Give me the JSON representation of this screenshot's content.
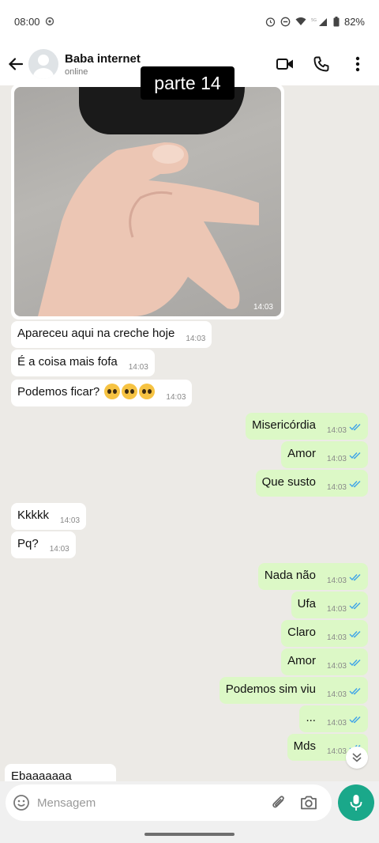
{
  "status_bar": {
    "time": "08:00",
    "battery": "82%"
  },
  "header": {
    "contact_name": "Baba internet",
    "status": "online"
  },
  "overlay": {
    "label": "parte 14"
  },
  "photo": {
    "time": "14:03"
  },
  "messages_in": [
    {
      "text": "Apareceu aqui na creche hoje",
      "time": "14:03"
    },
    {
      "text": "É a coisa mais fofa",
      "time": "14:03"
    },
    {
      "text": "Podemos ficar?",
      "time": "14:03"
    },
    {
      "text": "Kkkkk",
      "time": "14:03"
    },
    {
      "text": "Pq?",
      "time": "14:03"
    },
    {
      "text": "Ebaaaaaaa",
      "time": ""
    }
  ],
  "messages_out": [
    {
      "text": "Misericórdia",
      "time": "14:03"
    },
    {
      "text": "Amor",
      "time": "14:03"
    },
    {
      "text": "Que susto",
      "time": "14:03"
    },
    {
      "text": "Nada não",
      "time": "14:03"
    },
    {
      "text": "Ufa",
      "time": "14:03"
    },
    {
      "text": "Claro",
      "time": "14:03"
    },
    {
      "text": "Amor",
      "time": "14:03"
    },
    {
      "text": "Podemos sim viu",
      "time": "14:03"
    },
    {
      "text": "...",
      "time": "14:03"
    },
    {
      "text": "Mds",
      "time": "14:03"
    }
  ],
  "input": {
    "placeholder": "Mensagem"
  },
  "colors": {
    "outgoing_bubble": "#dcf8c6",
    "incoming_bubble": "#ffffff",
    "mic_button": "#1aa88a",
    "read_ticks": "#3ea3e8"
  }
}
